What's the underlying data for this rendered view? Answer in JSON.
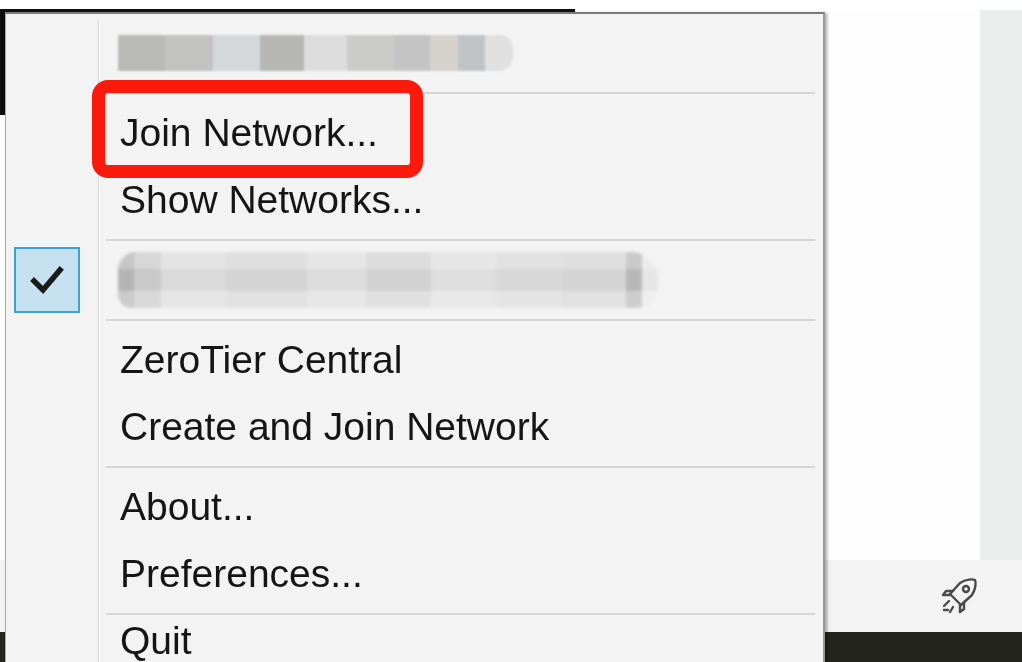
{
  "menu": {
    "items": [
      {
        "kind": "redacted",
        "checked": false,
        "highlighted": false
      },
      {
        "kind": "separator"
      },
      {
        "kind": "command",
        "label": "Join Network...",
        "checked": false,
        "highlighted": true
      },
      {
        "kind": "command",
        "label": "Show Networks...",
        "checked": false,
        "highlighted": false
      },
      {
        "kind": "separator"
      },
      {
        "kind": "redacted",
        "checked": true,
        "highlighted": false
      },
      {
        "kind": "separator"
      },
      {
        "kind": "command",
        "label": "ZeroTier Central",
        "checked": false,
        "highlighted": false
      },
      {
        "kind": "command",
        "label": "Create and Join Network",
        "checked": false,
        "highlighted": false
      },
      {
        "kind": "separator"
      },
      {
        "kind": "command",
        "label": "About...",
        "checked": false,
        "highlighted": false
      },
      {
        "kind": "command",
        "label": "Preferences...",
        "checked": false,
        "highlighted": false
      },
      {
        "kind": "separator"
      },
      {
        "kind": "command",
        "label": "Quit",
        "checked": false,
        "highlighted": false
      }
    ]
  }
}
